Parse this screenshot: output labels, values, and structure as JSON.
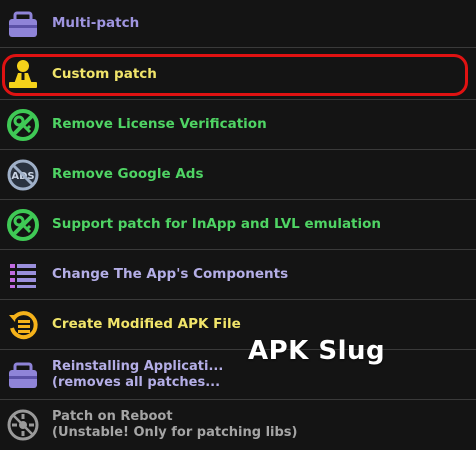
{
  "menu": {
    "items": [
      {
        "label": "Multi-patch",
        "icon": "toolbox-icon",
        "color": "#9f95e0"
      },
      {
        "label": "Custom patch",
        "icon": "person-at-desk-icon",
        "color": "#f1e56a"
      },
      {
        "label": "Remove License Verification",
        "icon": "no-key-icon",
        "color": "#4fd464"
      },
      {
        "label": "Remove Google Ads",
        "icon": "no-ads-icon",
        "color": "#4fd464"
      },
      {
        "label": "Support patch for InApp and LVL emulation",
        "icon": "no-key-icon",
        "color": "#4fd464"
      },
      {
        "label": "Change The App's Components",
        "icon": "component-list-icon",
        "color": "#b4aee6"
      },
      {
        "label": "Create Modified APK File",
        "icon": "rebuild-icon",
        "color": "#f1e56a"
      },
      {
        "label_line1": "Reinstalling Applicati...",
        "label_line2": "(removes all patches...",
        "icon": "toolbox-icon",
        "color": "#b4aee6"
      },
      {
        "label_line1": "Patch on Reboot",
        "label_line2": "(Unstable! Only for patching libs)",
        "icon": "reboot-patch-icon",
        "color": "#a5a5a5"
      }
    ]
  },
  "watermark": "APK Slug"
}
